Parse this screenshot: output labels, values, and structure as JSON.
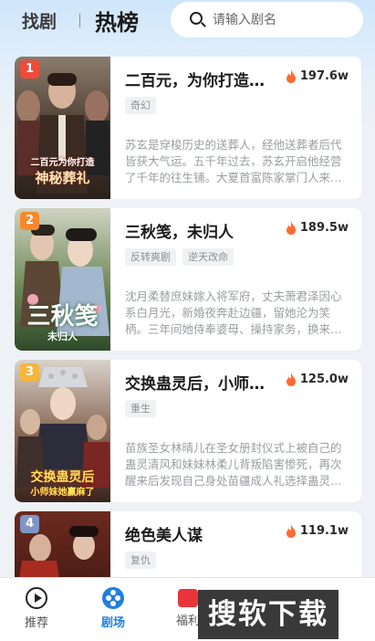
{
  "header": {
    "tab_find": "找剧",
    "tab_hot": "热榜",
    "search": {
      "placeholder": "请输入剧名",
      "icon": "search-icon"
    }
  },
  "colors": {
    "accent": "#1f7fe0",
    "fire": "#ff6b2c",
    "rank1": "#f04a3a",
    "rank2": "#f7892c",
    "rank3": "#f5b63a",
    "rank4": "#7f95c4"
  },
  "dramas": [
    {
      "rank": "1",
      "title": "二百元，为你打造神秘葬礼",
      "heat": "197.6w",
      "tags": [
        "奇幻"
      ],
      "desc": "苏玄是穿梭历史的送葬人，经他送葬者后代皆获大气运。五千年过去，苏玄开启他经营了千年的往生铺。大夏首富陈家掌门人来到铺子",
      "poster_title_1": "二百元为你打造",
      "poster_title_2": "神秘葬礼"
    },
    {
      "rank": "2",
      "title": "三秋笺，未归人",
      "heat": "189.5w",
      "tags": [
        "反转爽剧",
        "逆天改命"
      ],
      "desc": "沈月柔替庶妹嫁入将军府，丈夫萧君泽因心系白月光，新婚夜奔赴边疆，留她沦为笑柄。三年间她侍奉婆母、操持家务，换来的却是",
      "poster_title_1": "三秋笺",
      "poster_title_2": "未归人"
    },
    {
      "rank": "3",
      "title": "交换蛊灵后，小师妹她赢麻了",
      "heat": "125.0w",
      "tags": [
        "重生"
      ],
      "desc": "苗族圣女林晴儿在圣女册封仪式上被自己的蛊灵清风和妹妹林柔儿背叛陷害惨死，再次醒来后发现自己身处苗疆成人礼选择蛊灵之时",
      "poster_title_1": "交换蛊灵后",
      "poster_title_2": "小师妹她赢麻了"
    },
    {
      "rank": "4",
      "title": "绝色美人谋",
      "heat": "119.1w",
      "tags": [
        "复仇"
      ],
      "desc": ""
    }
  ],
  "nav": {
    "items": [
      {
        "label": "推荐",
        "icon": "play-icon"
      },
      {
        "label": "剧场",
        "icon": "theater-icon"
      },
      {
        "label": "福利",
        "icon": "welfare-icon"
      }
    ]
  },
  "watermark": "搜软下载"
}
